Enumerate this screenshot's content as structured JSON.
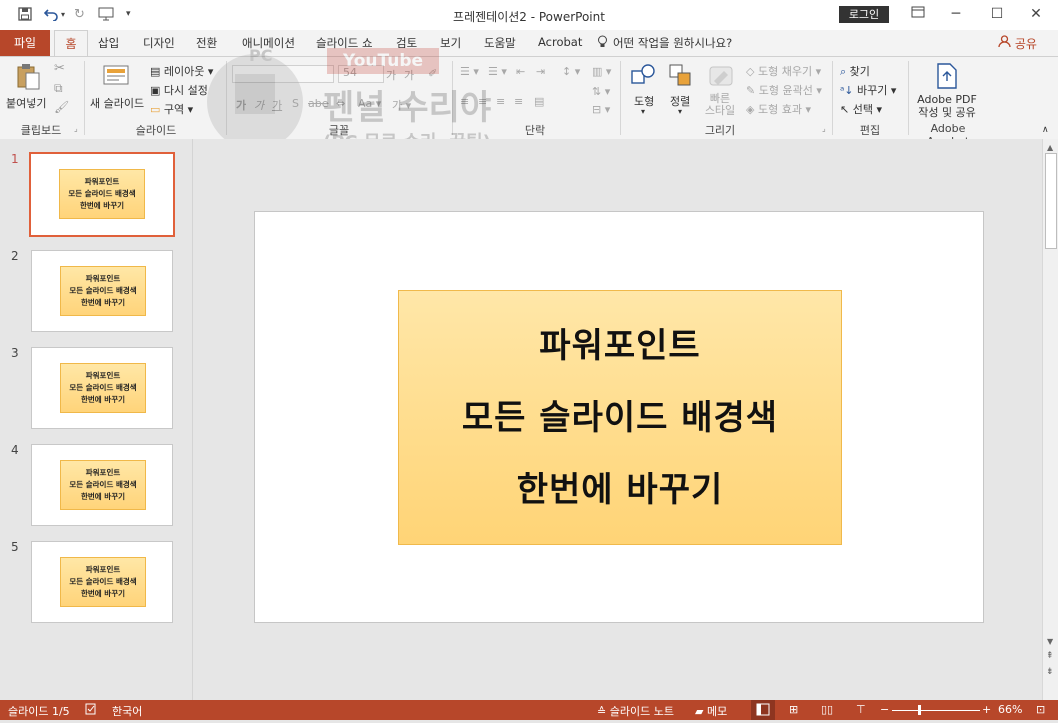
{
  "window": {
    "title": "프레젠테이션2 - PowerPoint",
    "login_label": "로그인",
    "controls": [
      "restore-ribbon",
      "minimize",
      "maximize",
      "close"
    ]
  },
  "qat": {
    "icons": [
      "save-icon",
      "undo-icon",
      "redo-icon",
      "present-from-start-icon",
      "customize-icon"
    ]
  },
  "tabs": {
    "file": "파일",
    "home": "홈",
    "items": [
      "삽입",
      "디자인",
      "전환",
      "애니메이션",
      "슬라이드 쇼",
      "검토",
      "보기",
      "도움말",
      "Acrobat"
    ],
    "tell_me": "어떤 작업을 원하시나요?",
    "share": "공유"
  },
  "ribbon": {
    "clipboard": {
      "label": "클립보드",
      "paste": "붙여넣기"
    },
    "slides": {
      "label": "슬라이드",
      "new_slide": "새 슬라이드",
      "layout": "레이아웃",
      "reset": "다시 설정",
      "section": "구역"
    },
    "font": {
      "label": "글꼴",
      "size": "54"
    },
    "paragraph": {
      "label": "단락"
    },
    "drawing": {
      "label": "그리기",
      "shapes": "도형",
      "arrange": "정렬",
      "quick_styles": "빠른\n스타일",
      "fill": "도형 채우기",
      "outline": "도형 윤곽선",
      "effects": "도형 효과"
    },
    "editing": {
      "label": "편집",
      "find": "찾기",
      "replace": "바꾸기",
      "select": "선택"
    },
    "acrobat": {
      "label": "Adobe Acrobat",
      "create": "Adobe PDF\n작성 및 공유"
    }
  },
  "watermark": {
    "line1": "PC",
    "line2": "YouTube",
    "line3": "펜널 수리야",
    "line4": "(PC 무료 수리, 꿀팁)"
  },
  "slides": [
    {
      "number": "1",
      "lines": [
        "파워포인트",
        "모든 슬라이드 배경색",
        "한번에 바꾸기"
      ],
      "selected": true
    },
    {
      "number": "2",
      "lines": [
        "파워포인트",
        "모든 슬라이드 배경색",
        "한번에 바꾸기"
      ],
      "selected": false
    },
    {
      "number": "3",
      "lines": [
        "파워포인트",
        "모든 슬라이드 배경색",
        "한번에 바꾸기"
      ],
      "selected": false
    },
    {
      "number": "4",
      "lines": [
        "파워포인트",
        "모든 슬라이드 배경색",
        "한번에 바꾸기"
      ],
      "selected": false
    },
    {
      "number": "5",
      "lines": [
        "파워포인트",
        "모든 슬라이드 배경색",
        "한번에 바꾸기"
      ],
      "selected": false
    }
  ],
  "main_slide": {
    "lines": [
      "파워포인트",
      "모든 슬라이드 배경색",
      "한번에 바꾸기"
    ]
  },
  "status": {
    "slide_pos": "슬라이드 1/5",
    "language": "한국어",
    "notes": "슬라이드 노트",
    "comments": "메모",
    "zoom": "66%"
  },
  "colors": {
    "accent": "#b7472a",
    "box_fill": "#ffd97f",
    "box_border": "#f0b94b",
    "selection": "#e0603a"
  }
}
